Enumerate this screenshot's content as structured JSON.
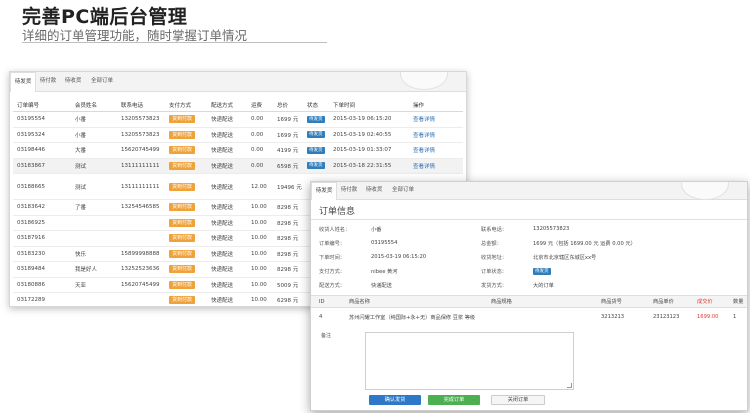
{
  "slide": {
    "title": "完善PC端后台管理",
    "subtitle": "详细的订单管理功能，随时掌握订单情况"
  },
  "order_list": {
    "tabs": [
      "待发货",
      "待付款",
      "待收货",
      "全部订单"
    ],
    "columns": [
      "订单编号",
      "会员姓名",
      "联系电话",
      "支付方式",
      "配送方式",
      "运费",
      "总价",
      "状态",
      "下单时间",
      "操作"
    ],
    "pay_button_label": "货到付款",
    "rows": [
      {
        "id": "03195554",
        "name": "小番",
        "phone": "13205573823",
        "delivery": "快递配送",
        "freight": "0.00",
        "total": "1699 元",
        "badge": "待发货",
        "time": "2015-03-19 06:15:20",
        "action": "查看详情"
      },
      {
        "id": "03195324",
        "name": "小番",
        "phone": "13205573823",
        "delivery": "快递配送",
        "freight": "0.00",
        "total": "1699 元",
        "badge": "待发货",
        "time": "2015-03-19 02:40:55",
        "action": "查看详情"
      },
      {
        "id": "03198446",
        "name": "大番",
        "phone": "15620745499",
        "delivery": "快递配送",
        "freight": "0.00",
        "total": "4199 元",
        "badge": "待发货",
        "time": "2015-03-19 01:33:07",
        "action": "查看详情"
      },
      {
        "id": "03183867",
        "name": "测试",
        "phone": "13111111111",
        "delivery": "快递配送",
        "freight": "0.00",
        "total": "6598 元",
        "badge": "待发货",
        "time": "2015-03-18 22:31:55",
        "action": "查看详情"
      },
      {
        "id": "03188665",
        "name": "测试",
        "phone": "13111111111",
        "delivery": "快递配送",
        "freight": "12.00",
        "total": "19496 元",
        "badge": "",
        "time": "",
        "action": ""
      },
      {
        "id": "03183642",
        "name": "了番",
        "phone": "13254546585",
        "delivery": "快递配送",
        "freight": "10.00",
        "total": "8298 元",
        "badge": "",
        "time": "",
        "action": ""
      },
      {
        "id": "03186925",
        "name": "",
        "phone": "",
        "delivery": "快递配送",
        "freight": "10.00",
        "total": "8298 元",
        "badge": "",
        "time": "",
        "action": ""
      },
      {
        "id": "03187916",
        "name": "",
        "phone": "",
        "delivery": "快递配送",
        "freight": "10.00",
        "total": "8298 元",
        "badge": "",
        "time": "",
        "action": ""
      },
      {
        "id": "03183230",
        "name": "快乐",
        "phone": "15899998888",
        "delivery": "快递配送",
        "freight": "10.00",
        "total": "8298 元",
        "badge": "",
        "time": "",
        "action": ""
      },
      {
        "id": "03189484",
        "name": "我是好人",
        "phone": "13252523636",
        "delivery": "快递配送",
        "freight": "10.00",
        "total": "8298 元",
        "badge": "",
        "time": "",
        "action": ""
      },
      {
        "id": "03180886",
        "name": "天亚",
        "phone": "15620745499",
        "delivery": "快递配送",
        "freight": "10.00",
        "total": "5009 元",
        "badge": "",
        "time": "",
        "action": ""
      },
      {
        "id": "03172289",
        "name": "",
        "phone": "",
        "delivery": "快递配送",
        "freight": "10.00",
        "total": "6298 元",
        "badge": "",
        "time": "",
        "action": ""
      }
    ]
  },
  "order_detail": {
    "tabs": [
      "待发货",
      "待付款",
      "待收货",
      "全部订单"
    ],
    "title": "订单信息",
    "fields": {
      "member_name_label": "收货人姓名：",
      "member_name": "小番",
      "phone_label": "联系电话：",
      "phone": "13205573823",
      "order_no_label": "订单编号：",
      "order_no": "03195554",
      "total_label": "总金额：",
      "total": "1699 元（包括 1699.00 元 运费 0.00 元）",
      "time_label": "下单时间：",
      "time": "2015-03-19 06:15:20",
      "address_label": "收货地址：",
      "address": "北京市北京辖区东城区xx号",
      "pay_label": "支付方式：",
      "pay": "nibee 黄河",
      "status_label": "订单状态：",
      "status": "待发货",
      "delivery_label": "配送方式：",
      "delivery": "快递配送",
      "invoice_label": "发货方式：",
      "invoice": "大的订单"
    },
    "table_columns": [
      "ID",
      "商品名称",
      "商品规格",
      "商品货号",
      "商品单价",
      "成交价",
      "数量"
    ],
    "item": {
      "id": "4",
      "name": "苏州闪耀工作室（纯国际+永+无）商品保修 豆浆 等级",
      "spec": "",
      "sku": "3213213",
      "unit_price": "23123123",
      "deal_price": "1699.00",
      "qty": "1"
    },
    "remark_label": "备注",
    "buttons": {
      "confirm": "确认发货",
      "complete": "完成订单",
      "close": "关闭订单"
    }
  }
}
